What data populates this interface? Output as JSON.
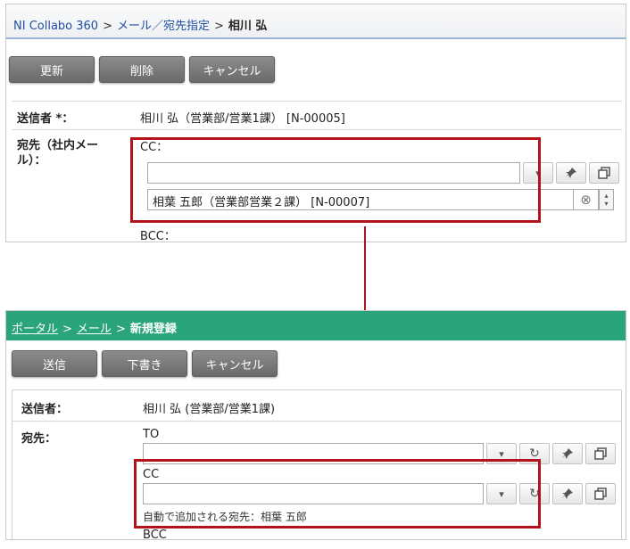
{
  "panel1": {
    "breadcrumb": {
      "root": "NI Collabo 360",
      "sep1": ">",
      "mid": "メール／宛先指定",
      "sep2": ">",
      "current": "相川 弘"
    },
    "buttons": {
      "update": "更新",
      "delete": "削除",
      "cancel": "キャンセル"
    },
    "sender": {
      "label": "送信者 *：",
      "value": "相川 弘（営業部/営業1課） [N-00005]"
    },
    "recipient": {
      "label_line1": "宛先（社内メー",
      "label_line2": "ル）："
    },
    "cc": {
      "label": "CC：",
      "input_value": "",
      "selected": "相葉 五郎（営業部営業２課） [N-00007]"
    },
    "bcc": {
      "label": "BCC："
    }
  },
  "panel2": {
    "breadcrumb": {
      "portal": "ポータル",
      "sep1": ">",
      "mail": "メール",
      "sep2": ">",
      "current": "新規登録"
    },
    "buttons": {
      "send": "送信",
      "draft": "下書き",
      "cancel": "キャンセル"
    },
    "sender": {
      "label": "送信者：",
      "value": "相川 弘 (営業部/営業1課)"
    },
    "recipient": {
      "label": "宛先："
    },
    "to": {
      "label": "TO",
      "input_value": ""
    },
    "cc": {
      "label": "CC",
      "input_value": "",
      "note": "自動で追加される宛先：相葉 五郎"
    },
    "bcc": {
      "label": "BCC"
    }
  },
  "icons": {
    "dropdown": "▾",
    "pin": "📌",
    "copy": "⧉",
    "clear": "⊗",
    "reset": "↻",
    "spin_up": "▴",
    "spin_down": "▾"
  },
  "colors": {
    "highlight": "#b3141c",
    "header_green": "#2aa57b",
    "button_gray": "#7a7a7a",
    "link_blue": "#1f4fa3"
  }
}
